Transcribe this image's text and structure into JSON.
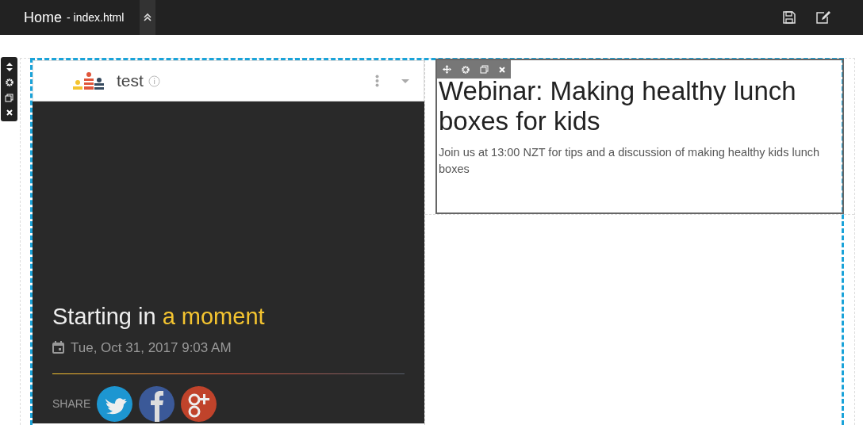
{
  "topbar": {
    "title": "Home",
    "file": "- index.html"
  },
  "event_card": {
    "name": "test",
    "heading": "Starting in",
    "heading_highlight": "a moment",
    "date": "Tue, Oct 31, 2017 9:03 AM",
    "share_label": "SHARE"
  },
  "text_block": {
    "title": "Webinar: Making healthy lunch boxes for kids",
    "description": "Join us at 13:00 NZT for tips and a discussion of making healthy kids lunch boxes"
  }
}
